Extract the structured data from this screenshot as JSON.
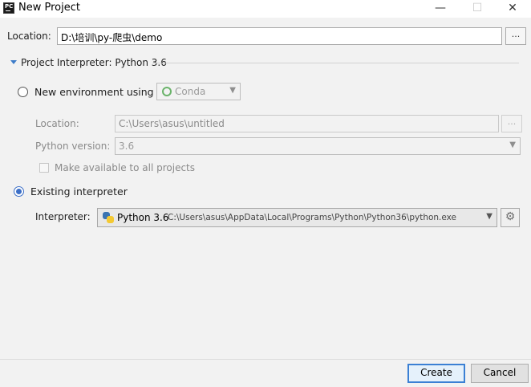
{
  "window": {
    "title": "New Project",
    "minimize_glyph": "—",
    "maximize_glyph": "☐",
    "close_glyph": "✕"
  },
  "location": {
    "label": "Location:",
    "value": "D:\\培训\\py-爬虫\\demo",
    "browse_label": "..."
  },
  "interpreter_section": {
    "header": "Project Interpreter: Python 3.6",
    "expanded": true,
    "new_environment": {
      "radio_label": "New environment using",
      "selected": false,
      "tool_value": "Conda",
      "location_label": "Location:",
      "location_value": "C:\\Users\\asus\\untitled",
      "browse_label": "...",
      "python_version_label": "Python version:",
      "python_version_value": "3.6",
      "make_available_label": "Make available to all projects",
      "make_available_checked": false
    },
    "existing_interpreter": {
      "radio_label": "Existing interpreter",
      "selected": true,
      "interpreter_label": "Interpreter:",
      "interpreter_name": "Python 3.6",
      "interpreter_path": "C:\\Users\\asus\\AppData\\Local\\Programs\\Python\\Python36\\python.exe"
    }
  },
  "buttons": {
    "create": "Create",
    "cancel": "Cancel"
  },
  "icons": {
    "app": "pycharm-icon",
    "dropdown": "chevron-down-icon",
    "settings": "gear-icon",
    "python": "python-icon",
    "conda": "conda-icon",
    "expand": "triangle-down-icon"
  },
  "colors": {
    "accent": "#3c6fc7",
    "default_button_border": "#3b80d4",
    "background": "#f2f2f2"
  }
}
